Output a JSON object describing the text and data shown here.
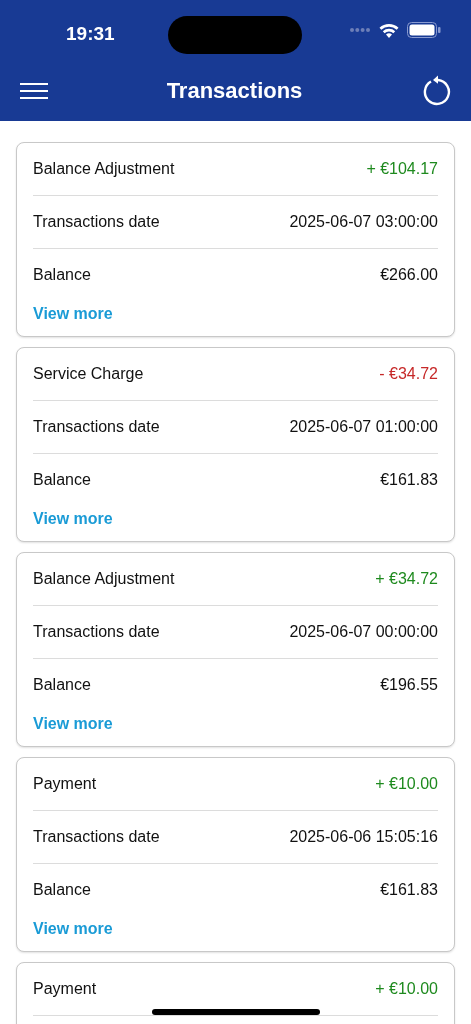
{
  "status_bar": {
    "time": "19:31"
  },
  "header": {
    "title": "Transactions"
  },
  "transactions": [
    {
      "type": "Balance Adjustment",
      "amount": "+ €104.17",
      "kind": "credit",
      "date_label": "Transactions date",
      "date": "2025-06-07 03:00:00",
      "balance_label": "Balance",
      "balance": "€266.00",
      "link": "View more"
    },
    {
      "type": "Service Charge",
      "amount": "- €34.72",
      "kind": "debit",
      "date_label": "Transactions date",
      "date": "2025-06-07 01:00:00",
      "balance_label": "Balance",
      "balance": "€161.83",
      "link": "View more"
    },
    {
      "type": "Balance Adjustment",
      "amount": "+ €34.72",
      "kind": "credit",
      "date_label": "Transactions date",
      "date": "2025-06-07 00:00:00",
      "balance_label": "Balance",
      "balance": "€196.55",
      "link": "View more"
    },
    {
      "type": "Payment",
      "amount": "+ €10.00",
      "kind": "credit",
      "date_label": "Transactions date",
      "date": "2025-06-06 15:05:16",
      "balance_label": "Balance",
      "balance": "€161.83",
      "link": "View more"
    },
    {
      "type": "Payment",
      "amount": "+ €10.00",
      "kind": "credit"
    }
  ]
}
